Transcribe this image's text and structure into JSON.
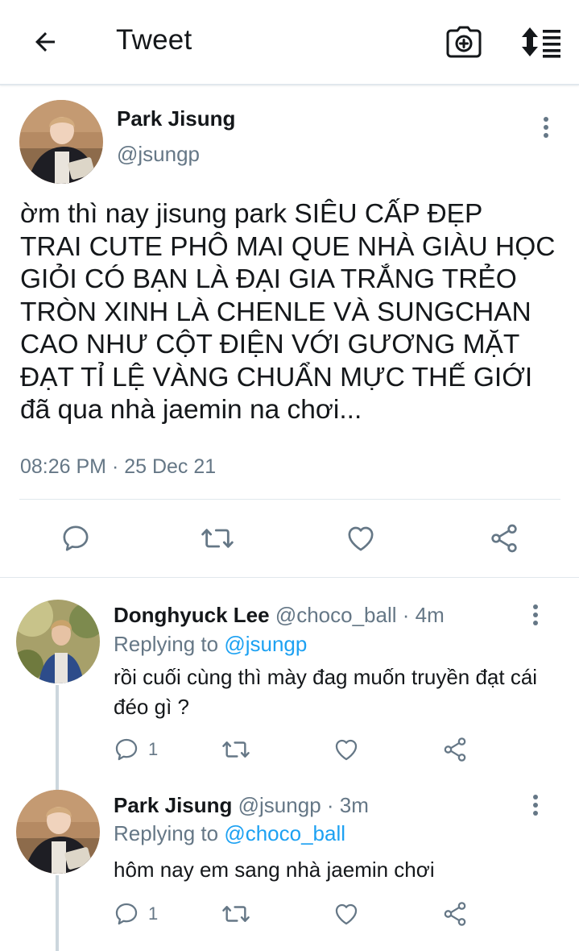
{
  "header": {
    "title": "Tweet",
    "back_icon": "arrow-left-icon",
    "camera_icon": "camera-plus-icon",
    "sort_icon": "sort-list-icon"
  },
  "main_tweet": {
    "author_name": "Park Jisung",
    "author_handle": "@jsungp",
    "text": "ờm thì nay jisung park SIÊU CẤP ĐẸP\nTRAI CUTE PHÔ MAI QUE NHÀ GIÀU HỌC\nGIỎI CÓ BẠN LÀ ĐẠI GIA TRẮNG TRẺO\nTRÒN XINH LÀ CHENLE VÀ SUNGCHAN\nCAO NHƯ CỘT ĐIỆN VỚI GƯƠNG MẶT\nĐẠT TỈ LỆ VÀNG CHUẨN MỰC THẾ GIỚI\nđã qua nhà jaemin na chơi...",
    "timestamp": "08:26 PM · 25 Dec 21"
  },
  "replies": [
    {
      "name": "Donghyuck Lee",
      "meta": "@choco_ball · 4m",
      "replying_label": "Replying to",
      "replying_to": "@jsungp",
      "text": "rồi cuối cùng thì mày đag muốn truyền đạt cái đéo gì ?",
      "reply_count": "1"
    },
    {
      "name": "Park Jisung",
      "meta": "@jsungp · 3m",
      "replying_label": "Replying to",
      "replying_to": "@choco_ball",
      "text": "hôm nay em sang nhà jaemin chơi",
      "reply_count": "1"
    }
  ],
  "colors": {
    "text": "#14171a",
    "muted": "#657786",
    "link": "#1da1f2",
    "divider": "#e1e8ed",
    "icon": "#657786"
  }
}
